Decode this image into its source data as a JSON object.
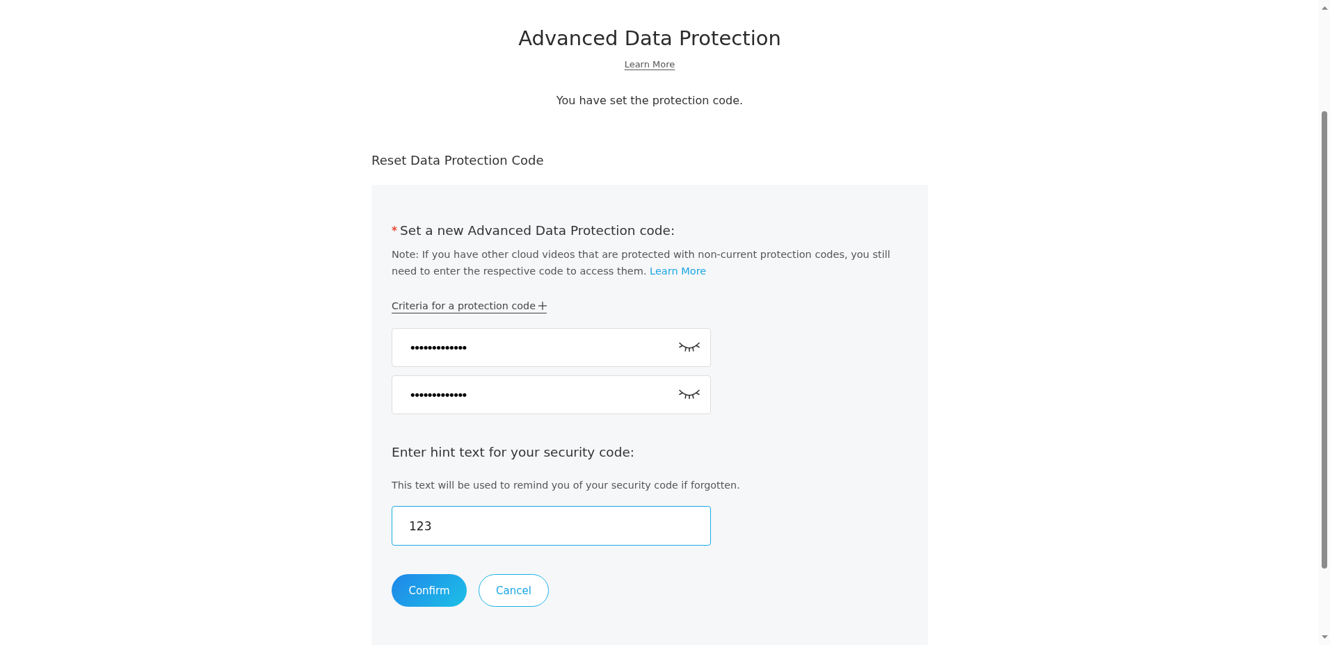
{
  "page": {
    "title": "Advanced Data Protection",
    "learn_more": "Learn More",
    "status": "You have set the protection code."
  },
  "section": {
    "title": "Reset Data Protection Code"
  },
  "form": {
    "code_label": {
      "text": "Set a new Advanced Data Protection code:",
      "required": true
    },
    "note": {
      "text": "Note: If you have other cloud videos that are protected with non-current protection codes, you still need to enter the respective code to access them.",
      "link": "Learn More"
    },
    "criteria_link": {
      "text": "Criteria for a protection code",
      "expanded": false
    },
    "code_fields": [
      {
        "value": "•••••••••••••",
        "revealed": false
      },
      {
        "value": "•••••••••••••",
        "revealed": false
      }
    ],
    "hint_label": "Enter hint text for your security code:",
    "hint_description": "This text will be used to remind you of your security code if forgotten.",
    "hint_field": {
      "value": "123",
      "focused": true
    },
    "buttons": [
      {
        "label": "Confirm",
        "kind": "primary"
      },
      {
        "label": "Cancel",
        "kind": "secondary"
      }
    ]
  }
}
